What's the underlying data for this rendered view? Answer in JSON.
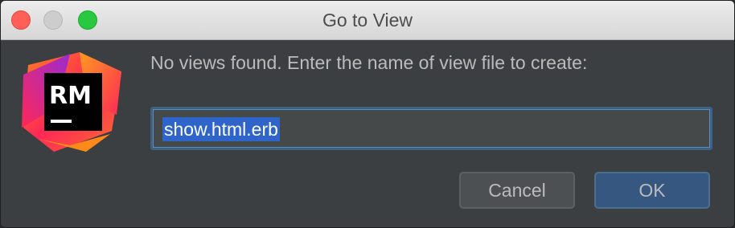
{
  "window": {
    "title": "Go to View"
  },
  "logo": {
    "text": "RM",
    "icon": "rubymine-logo-icon"
  },
  "dialog": {
    "message": "No views found. Enter the name of view file to create:",
    "input_value": "show.html.erb"
  },
  "buttons": {
    "cancel_label": "Cancel",
    "ok_label": "OK"
  },
  "colors": {
    "dialog_bg": "#3c3f41",
    "accent": "#365880",
    "selection": "#2f65ca",
    "focus_border": "#3d6185"
  }
}
